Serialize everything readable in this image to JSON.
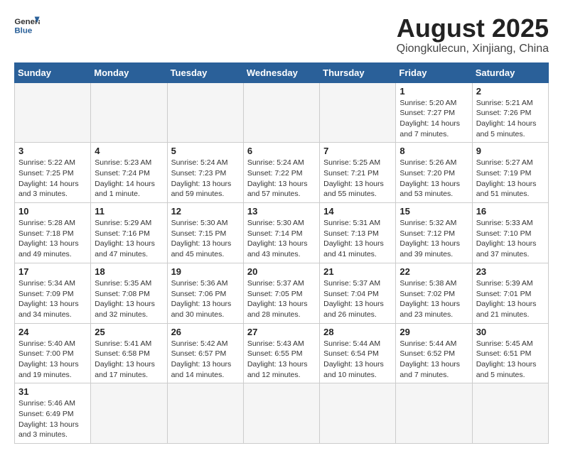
{
  "logo": {
    "line1": "General",
    "line2": "Blue"
  },
  "title": "August 2025",
  "location": "Qiongkulecun, Xinjiang, China",
  "days_of_week": [
    "Sunday",
    "Monday",
    "Tuesday",
    "Wednesday",
    "Thursday",
    "Friday",
    "Saturday"
  ],
  "weeks": [
    [
      {
        "day": "",
        "info": ""
      },
      {
        "day": "",
        "info": ""
      },
      {
        "day": "",
        "info": ""
      },
      {
        "day": "",
        "info": ""
      },
      {
        "day": "",
        "info": ""
      },
      {
        "day": "1",
        "info": "Sunrise: 5:20 AM\nSunset: 7:27 PM\nDaylight: 14 hours and 7 minutes."
      },
      {
        "day": "2",
        "info": "Sunrise: 5:21 AM\nSunset: 7:26 PM\nDaylight: 14 hours and 5 minutes."
      }
    ],
    [
      {
        "day": "3",
        "info": "Sunrise: 5:22 AM\nSunset: 7:25 PM\nDaylight: 14 hours and 3 minutes."
      },
      {
        "day": "4",
        "info": "Sunrise: 5:23 AM\nSunset: 7:24 PM\nDaylight: 14 hours and 1 minute."
      },
      {
        "day": "5",
        "info": "Sunrise: 5:24 AM\nSunset: 7:23 PM\nDaylight: 13 hours and 59 minutes."
      },
      {
        "day": "6",
        "info": "Sunrise: 5:24 AM\nSunset: 7:22 PM\nDaylight: 13 hours and 57 minutes."
      },
      {
        "day": "7",
        "info": "Sunrise: 5:25 AM\nSunset: 7:21 PM\nDaylight: 13 hours and 55 minutes."
      },
      {
        "day": "8",
        "info": "Sunrise: 5:26 AM\nSunset: 7:20 PM\nDaylight: 13 hours and 53 minutes."
      },
      {
        "day": "9",
        "info": "Sunrise: 5:27 AM\nSunset: 7:19 PM\nDaylight: 13 hours and 51 minutes."
      }
    ],
    [
      {
        "day": "10",
        "info": "Sunrise: 5:28 AM\nSunset: 7:18 PM\nDaylight: 13 hours and 49 minutes."
      },
      {
        "day": "11",
        "info": "Sunrise: 5:29 AM\nSunset: 7:16 PM\nDaylight: 13 hours and 47 minutes."
      },
      {
        "day": "12",
        "info": "Sunrise: 5:30 AM\nSunset: 7:15 PM\nDaylight: 13 hours and 45 minutes."
      },
      {
        "day": "13",
        "info": "Sunrise: 5:30 AM\nSunset: 7:14 PM\nDaylight: 13 hours and 43 minutes."
      },
      {
        "day": "14",
        "info": "Sunrise: 5:31 AM\nSunset: 7:13 PM\nDaylight: 13 hours and 41 minutes."
      },
      {
        "day": "15",
        "info": "Sunrise: 5:32 AM\nSunset: 7:12 PM\nDaylight: 13 hours and 39 minutes."
      },
      {
        "day": "16",
        "info": "Sunrise: 5:33 AM\nSunset: 7:10 PM\nDaylight: 13 hours and 37 minutes."
      }
    ],
    [
      {
        "day": "17",
        "info": "Sunrise: 5:34 AM\nSunset: 7:09 PM\nDaylight: 13 hours and 34 minutes."
      },
      {
        "day": "18",
        "info": "Sunrise: 5:35 AM\nSunset: 7:08 PM\nDaylight: 13 hours and 32 minutes."
      },
      {
        "day": "19",
        "info": "Sunrise: 5:36 AM\nSunset: 7:06 PM\nDaylight: 13 hours and 30 minutes."
      },
      {
        "day": "20",
        "info": "Sunrise: 5:37 AM\nSunset: 7:05 PM\nDaylight: 13 hours and 28 minutes."
      },
      {
        "day": "21",
        "info": "Sunrise: 5:37 AM\nSunset: 7:04 PM\nDaylight: 13 hours and 26 minutes."
      },
      {
        "day": "22",
        "info": "Sunrise: 5:38 AM\nSunset: 7:02 PM\nDaylight: 13 hours and 23 minutes."
      },
      {
        "day": "23",
        "info": "Sunrise: 5:39 AM\nSunset: 7:01 PM\nDaylight: 13 hours and 21 minutes."
      }
    ],
    [
      {
        "day": "24",
        "info": "Sunrise: 5:40 AM\nSunset: 7:00 PM\nDaylight: 13 hours and 19 minutes."
      },
      {
        "day": "25",
        "info": "Sunrise: 5:41 AM\nSunset: 6:58 PM\nDaylight: 13 hours and 17 minutes."
      },
      {
        "day": "26",
        "info": "Sunrise: 5:42 AM\nSunset: 6:57 PM\nDaylight: 13 hours and 14 minutes."
      },
      {
        "day": "27",
        "info": "Sunrise: 5:43 AM\nSunset: 6:55 PM\nDaylight: 13 hours and 12 minutes."
      },
      {
        "day": "28",
        "info": "Sunrise: 5:44 AM\nSunset: 6:54 PM\nDaylight: 13 hours and 10 minutes."
      },
      {
        "day": "29",
        "info": "Sunrise: 5:44 AM\nSunset: 6:52 PM\nDaylight: 13 hours and 7 minutes."
      },
      {
        "day": "30",
        "info": "Sunrise: 5:45 AM\nSunset: 6:51 PM\nDaylight: 13 hours and 5 minutes."
      }
    ],
    [
      {
        "day": "31",
        "info": "Sunrise: 5:46 AM\nSunset: 6:49 PM\nDaylight: 13 hours and 3 minutes."
      },
      {
        "day": "",
        "info": ""
      },
      {
        "day": "",
        "info": ""
      },
      {
        "day": "",
        "info": ""
      },
      {
        "day": "",
        "info": ""
      },
      {
        "day": "",
        "info": ""
      },
      {
        "day": "",
        "info": ""
      }
    ]
  ]
}
